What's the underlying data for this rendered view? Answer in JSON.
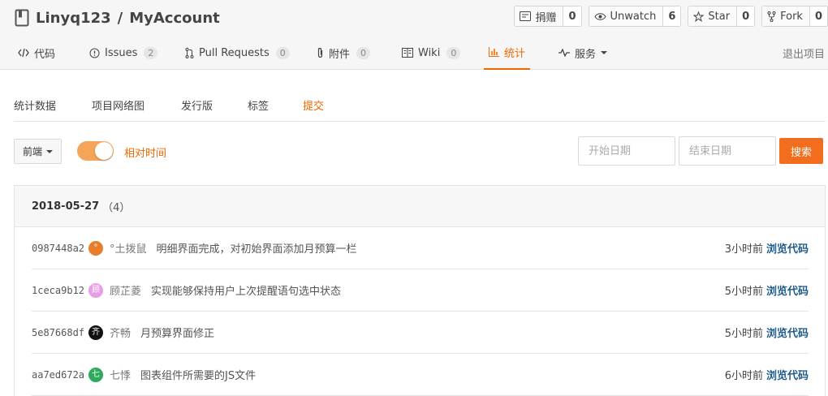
{
  "repo": {
    "owner": "Linyq123",
    "separator": "/",
    "name": "MyAccount"
  },
  "actions": [
    {
      "label": "捐赠",
      "count": "0",
      "icon": "donate-icon"
    },
    {
      "label": "Unwatch",
      "count": "6",
      "icon": "eye-icon"
    },
    {
      "label": "Star",
      "count": "0",
      "icon": "star-icon"
    },
    {
      "label": "Fork",
      "count": "0",
      "icon": "fork-icon"
    }
  ],
  "nav": {
    "code": "代码",
    "issues": "Issues",
    "issues_count": "2",
    "pulls": "Pull Requests",
    "pulls_count": "0",
    "attachments": "附件",
    "attachments_count": "0",
    "wiki": "Wiki",
    "wiki_count": "0",
    "stats": "统计",
    "services": "服务",
    "exit": "退出项目"
  },
  "subtabs": [
    "统计数据",
    "项目网络图",
    "发行版",
    "标签",
    "提交"
  ],
  "active_subtab": "提交",
  "filter": {
    "branch": "前端",
    "relative_time_label": "相对时间",
    "relative_time_on": true,
    "start_placeholder": "开始日期",
    "end_placeholder": "结束日期",
    "search_label": "搜索"
  },
  "accent_color": "#f06600",
  "commit_group": {
    "date": "2018-05-27",
    "count": "（4）",
    "commits": [
      {
        "sha": "0987448a2",
        "avatar_text": "°",
        "avatar_color": "#e87e2c",
        "author": "°土拨鼠",
        "message": "明细界面完成，对初始界面添加月预算一栏",
        "time": "3小时前",
        "browse": "浏览代码"
      },
      {
        "sha": "1ceca9b12",
        "avatar_text": "顾",
        "avatar_color": "#e79ee6",
        "author": "顾芷菱",
        "message": "实现能够保持用户上次提醒语句选中状态",
        "time": "5小时前",
        "browse": "浏览代码"
      },
      {
        "sha": "5e87668df",
        "avatar_text": "齐",
        "avatar_color": "#111111",
        "author": "齐畅",
        "message": "月预算界面修正",
        "time": "5小时前",
        "browse": "浏览代码"
      },
      {
        "sha": "aa7ed672a",
        "avatar_text": "七",
        "avatar_color": "#2eaa5a",
        "author": "七悸",
        "message": "图表组件所需要的JS文件",
        "time": "6小时前",
        "browse": "浏览代码"
      }
    ]
  }
}
